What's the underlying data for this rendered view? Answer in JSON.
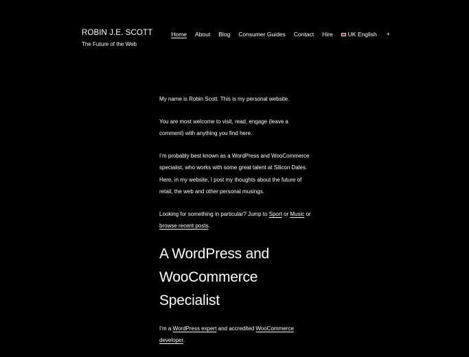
{
  "header": {
    "site_title": "ROBIN J.E. SCOTT",
    "tagline": "The Future of the Web"
  },
  "nav": {
    "items": [
      {
        "label": "Home",
        "current": true
      },
      {
        "label": "About"
      },
      {
        "label": "Blog"
      },
      {
        "label": "Consumer Guides"
      },
      {
        "label": "Contact"
      },
      {
        "label": "Hire"
      },
      {
        "label": "UK English",
        "icon": "uk-flag-icon"
      }
    ],
    "expand_label": "+"
  },
  "main": {
    "p1": "My name is Robin Scott. This is my personal website.",
    "p2": "You are most welcome to visit, read, engage (leave a comment) with anything you find here.",
    "p3": "I’m probably best known as a WordPress and WooCommerce specialist, who works with some great talent at Silicon Dales. Here, in my website, I post my thoughts about the future of retail, the web and other personal musings.",
    "p4": {
      "before": "Looking for something in particular? Jump to ",
      "link_sport": "Sport",
      "mid1": " or ",
      "link_music": "Music",
      "mid2": " or ",
      "link_browse": "browse recent posts",
      "after": "."
    },
    "heading": "A WordPress and WooCommerce Specialist",
    "p5": {
      "before": "I’m a ",
      "link_expert": "WordPress expert",
      "mid": " and accredited ",
      "link_dev": "WooCommerce developer",
      "after": "."
    }
  },
  "colors": {
    "background": "#000000",
    "text": "#ffffff"
  }
}
